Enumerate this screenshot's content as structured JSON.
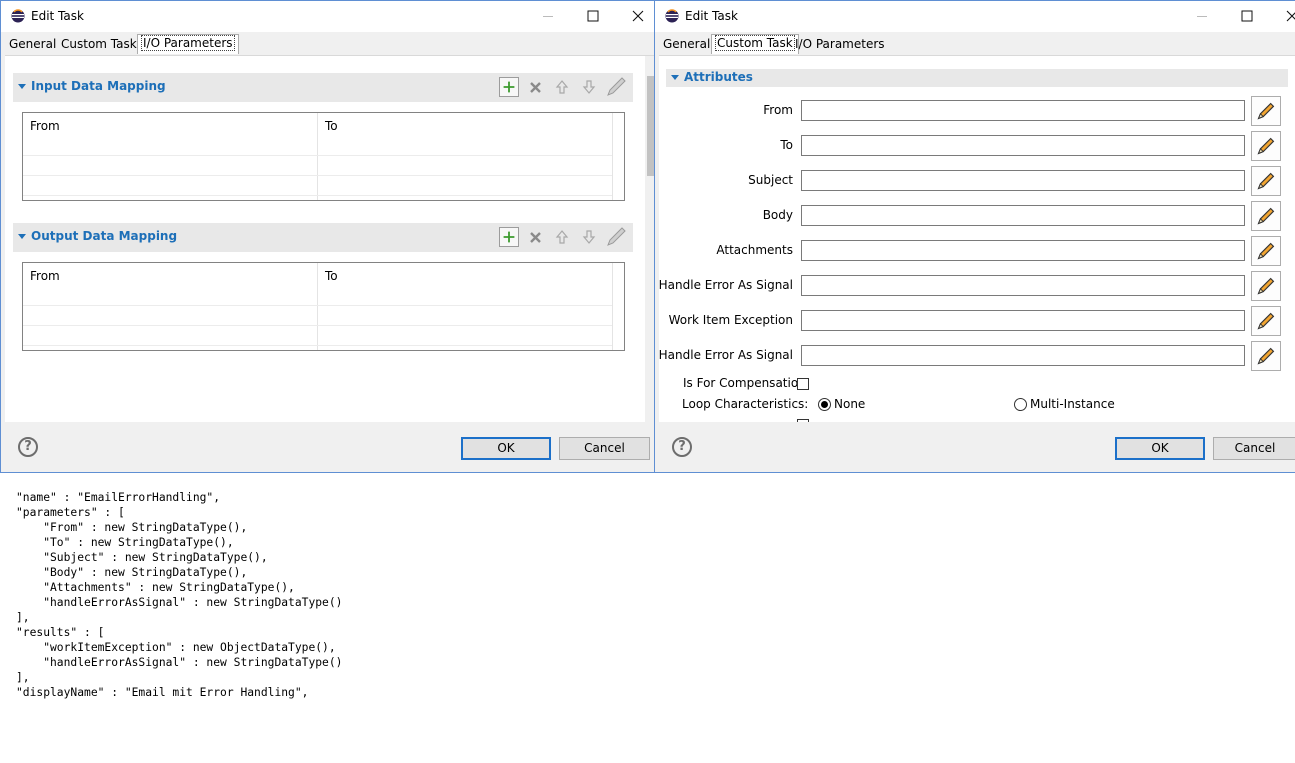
{
  "left_dialog": {
    "title": "Edit Task",
    "tabs": [
      "General",
      "Custom Task",
      "I/O Parameters"
    ],
    "active_tab": "I/O Parameters",
    "input_section": {
      "title": "Input Data Mapping",
      "columns": [
        "From",
        "To"
      ],
      "rows": []
    },
    "output_section": {
      "title": "Output Data Mapping",
      "columns": [
        "From",
        "To"
      ],
      "rows": []
    },
    "ok_label": "OK",
    "cancel_label": "Cancel"
  },
  "right_dialog": {
    "title": "Edit Task",
    "tabs": [
      "General",
      "Custom Task",
      "I/O Parameters"
    ],
    "active_tab": "Custom Task",
    "section_title": "Attributes",
    "fields": [
      {
        "label": "From",
        "value": ""
      },
      {
        "label": "To",
        "value": ""
      },
      {
        "label": "Subject",
        "value": ""
      },
      {
        "label": "Body",
        "value": ""
      },
      {
        "label": "Attachments",
        "value": ""
      },
      {
        "label": "Handle Error As Signal",
        "value": ""
      },
      {
        "label": "Work Item Exception",
        "value": ""
      },
      {
        "label": "Handle Error As Signal",
        "value": ""
      }
    ],
    "is_for_compensation_label": "Is For Compensation",
    "is_for_compensation_checked": false,
    "loop_label": "Loop Characteristics:",
    "loop_options": [
      "None",
      "Multi-Instance"
    ],
    "loop_selected": "None",
    "ok_label": "OK",
    "cancel_label": "Cancel"
  },
  "code_lines": [
    "\"name\" : \"EmailErrorHandling\",",
    "\"parameters\" : [",
    "    \"From\" : new StringDataType(),",
    "    \"To\" : new StringDataType(),",
    "    \"Subject\" : new StringDataType(),",
    "    \"Body\" : new StringDataType(),",
    "    \"Attachments\" : new StringDataType(),",
    "    \"handleErrorAsSignal\" : new StringDataType()",
    "],",
    "\"results\" : [",
    "    \"workItemException\" : new ObjectDataType(),",
    "    \"handleErrorAsSignal\" : new StringDataType()",
    "],",
    "\"displayName\" : \"Email mit Error Handling\","
  ],
  "icons": {
    "app": "eclipse-icon",
    "minimize": "minimize-icon",
    "maximize": "maximize-icon",
    "close": "close-icon",
    "add": "add-icon",
    "remove": "remove-icon",
    "up": "arrow-up-icon",
    "down": "arrow-down-icon",
    "edit": "pencil-icon",
    "help": "help-icon"
  }
}
